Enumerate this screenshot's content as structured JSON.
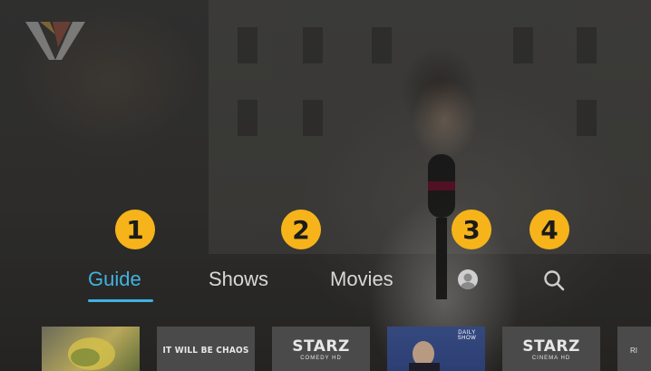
{
  "steps": [
    "1",
    "2",
    "3",
    "4"
  ],
  "nav": {
    "items": [
      {
        "label": "Guide",
        "active": true
      },
      {
        "label": "Shows",
        "active": false
      },
      {
        "label": "Movies",
        "active": false
      }
    ],
    "profile_icon": "user-avatar-icon",
    "search_icon": "search-icon"
  },
  "thumbnails": [
    {
      "kind": "artwork",
      "title": ""
    },
    {
      "kind": "text",
      "title": "IT WILL BE CHAOS"
    },
    {
      "kind": "channel",
      "title": "STARZ",
      "subtitle": "COMEDY HD"
    },
    {
      "kind": "artwork",
      "title": "DAILY SHOW"
    },
    {
      "kind": "channel",
      "title": "STARZ",
      "subtitle": "CINEMA HD"
    },
    {
      "kind": "text",
      "title": "RI"
    }
  ],
  "colors": {
    "accent": "#3fb3e0",
    "badge": "#f6b41a",
    "nav_text": "#d8d8d8"
  }
}
